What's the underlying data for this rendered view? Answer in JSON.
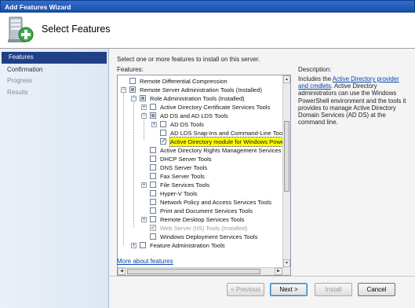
{
  "window": {
    "title": "Add Features Wizard"
  },
  "header": {
    "title": "Select Features",
    "icon": "server-features-icon"
  },
  "nav": {
    "items": [
      {
        "label": "Features",
        "state": "active"
      },
      {
        "label": "Confirmation",
        "state": "normal"
      },
      {
        "label": "Progress",
        "state": "disabled"
      },
      {
        "label": "Results",
        "state": "disabled"
      }
    ]
  },
  "main": {
    "instructions": "Select one or more features to install on this server.",
    "features_label": "Features:",
    "more_link": "More about features"
  },
  "tree": [
    {
      "label": "Remote Differential Compression"
    },
    {
      "label": "Remote Server Administration Tools  (Installed)"
    },
    {
      "label": "Role Administration Tools  (Installed)"
    },
    {
      "label": "Active Directory Certificate Services Tools"
    },
    {
      "label": "AD DS and AD LDS Tools"
    },
    {
      "label": "AD DS Tools"
    },
    {
      "label": "AD LDS Snap-Ins and Command-Line Tools"
    },
    {
      "label": "Active Directory module for Windows PowerSh"
    },
    {
      "label": "Active Directory Rights Management Services Too"
    },
    {
      "label": "DHCP Server Tools"
    },
    {
      "label": "DNS Server Tools"
    },
    {
      "label": "Fax Server Tools"
    },
    {
      "label": "File Services Tools"
    },
    {
      "label": "Hyper-V Tools"
    },
    {
      "label": "Network Policy and Access Services Tools"
    },
    {
      "label": "Print and Document Services Tools"
    },
    {
      "label": "Remote Desktop Services Tools"
    },
    {
      "label": "Web Server (IIS) Tools  (Installed)"
    },
    {
      "label": "Windows Deployment Services Tools"
    },
    {
      "label": "Feature Administration Tools"
    }
  ],
  "description": {
    "label": "Description:",
    "prefix": "Includes the ",
    "link": "Active Directory provider and cmdlets",
    "suffix": ". Active Directory administrators can use the Windows PowerShell environment and the tools it provides to manage Active Directory Domain Services (AD DS) at the command line."
  },
  "buttons": {
    "previous": "< Previous",
    "next": "Next >",
    "install": "Install",
    "cancel": "Cancel"
  },
  "colors": {
    "titlebar": "#1a4ea8",
    "nav_active": "#1f3f86",
    "highlight": "#ffff00",
    "link": "#0645ad"
  }
}
